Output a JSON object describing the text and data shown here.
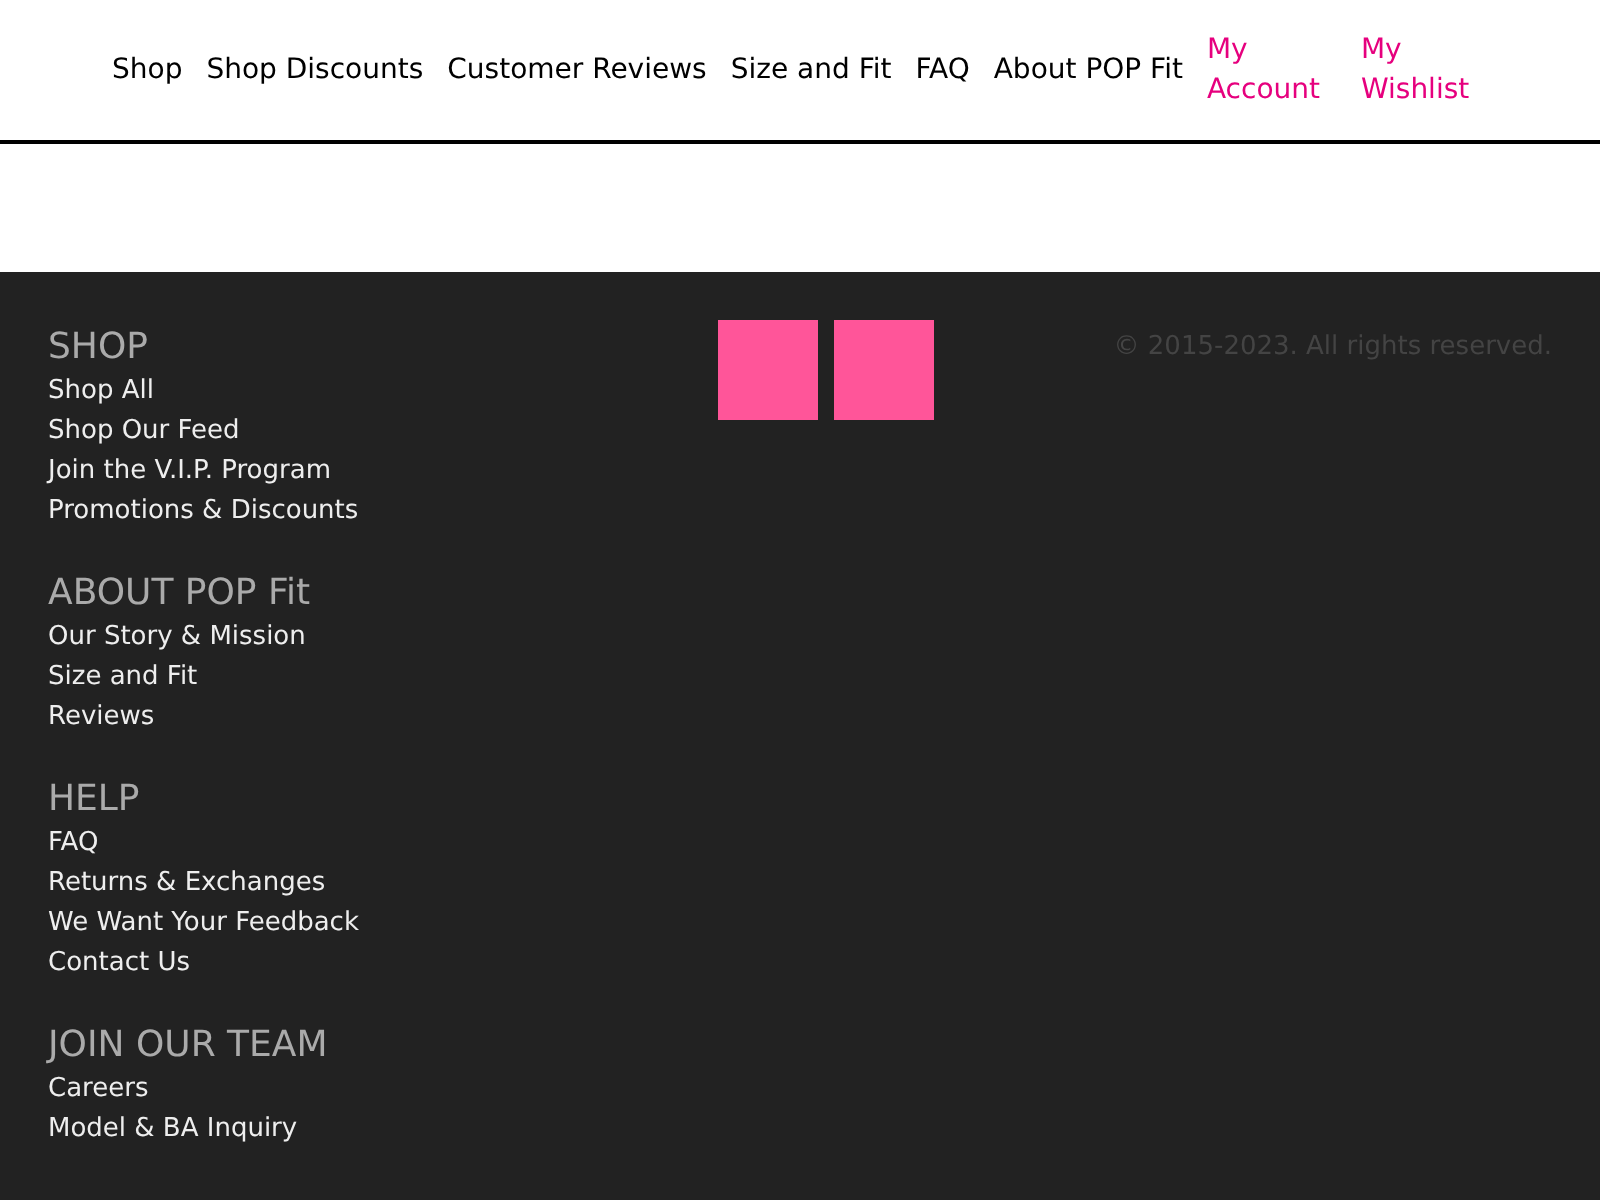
{
  "nav": {
    "links": [
      {
        "label": "Shop"
      },
      {
        "label": "Shop Discounts"
      },
      {
        "label": "Customer Reviews"
      },
      {
        "label": "Size and Fit"
      },
      {
        "label": "FAQ"
      },
      {
        "label": "About POP Fit"
      }
    ],
    "account_links": [
      {
        "label": "My Account"
      },
      {
        "label": "My Wishlist"
      }
    ]
  },
  "footer": {
    "sections": [
      {
        "heading": "SHOP",
        "links": [
          "Shop All",
          "Shop Our Feed",
          "Join the V.I.P. Program",
          "Promotions & Discounts"
        ]
      },
      {
        "heading": "ABOUT POP Fit",
        "links": [
          "Our Story & Mission",
          "Size and Fit",
          "Reviews"
        ]
      },
      {
        "heading": "HELP",
        "links": [
          "FAQ",
          "Returns & Exchanges",
          "We Want Your Feedback",
          "Contact Us"
        ]
      },
      {
        "heading": "JOIN OUR TEAM",
        "links": [
          "Careers",
          "Model & BA Inquiry"
        ]
      }
    ],
    "social_links": [
      {
        "kind": "square"
      },
      {
        "kind": "square"
      }
    ],
    "copyright": "© 2015-2023. All rights reserved."
  }
}
